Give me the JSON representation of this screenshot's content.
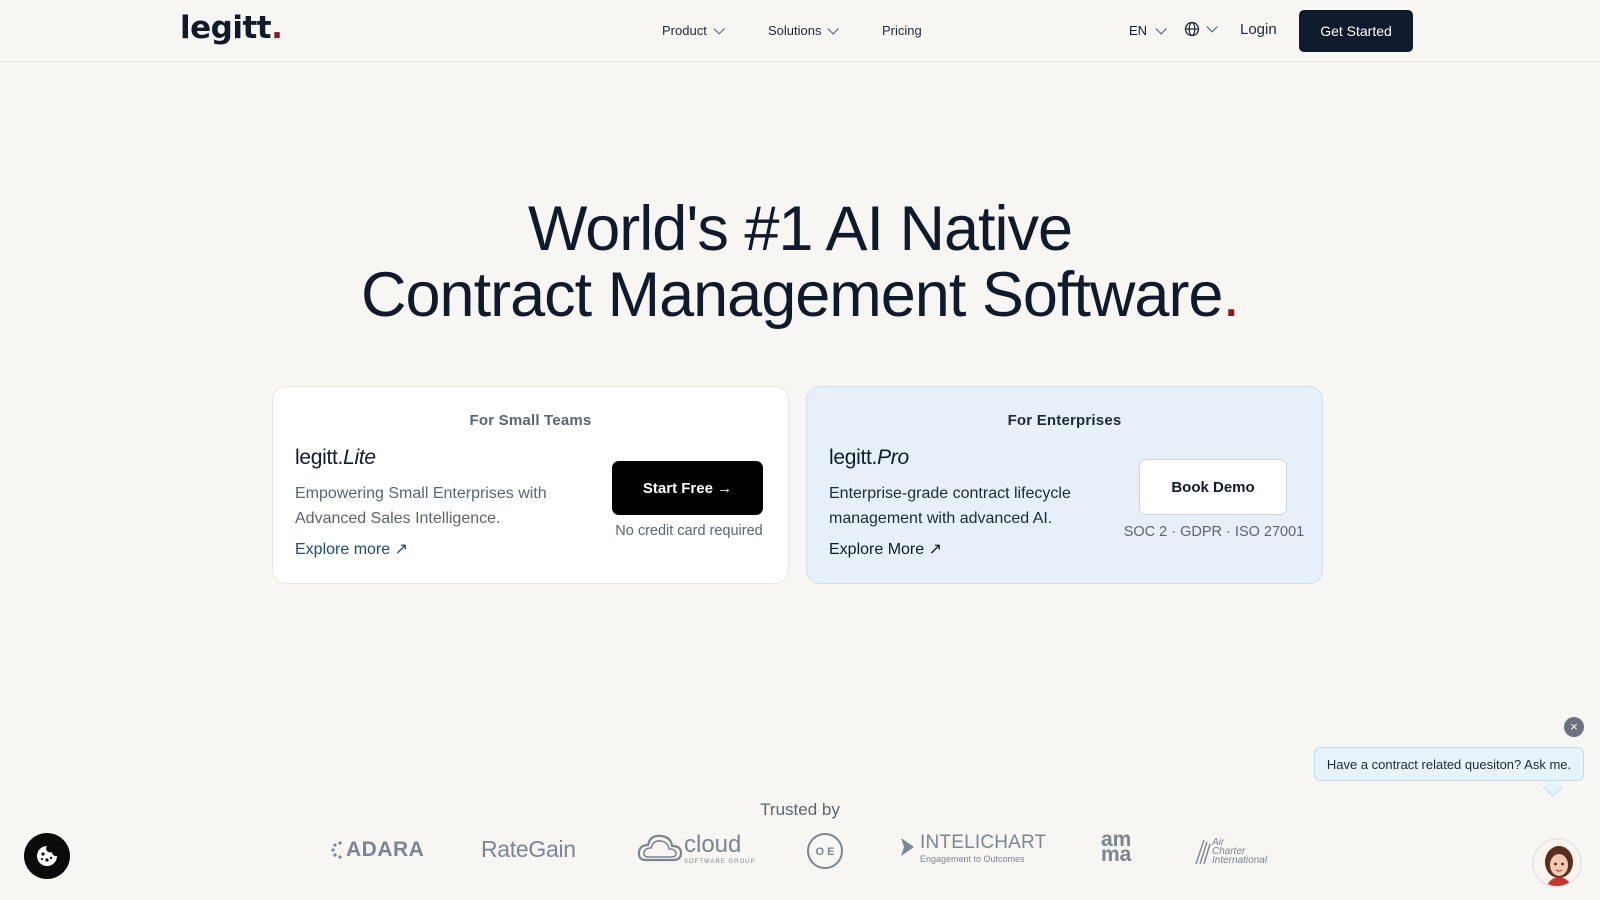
{
  "header": {
    "logo_text": "legitt",
    "logo_dot": ".",
    "nav": [
      {
        "label": "Product"
      },
      {
        "label": "Solutions"
      },
      {
        "label": "Pricing"
      }
    ],
    "language": "EN",
    "login_label": "Login",
    "get_started_label": "Get Started"
  },
  "hero": {
    "line1": "World's #1 AI Native",
    "line2": "Contract Management Software",
    "dot": "."
  },
  "cards": {
    "lite": {
      "kicker": "For Small Teams",
      "brand": "legitt.",
      "brand_suffix": "Lite",
      "description": "Empowering Small Enterprises with Advanced Sales Intelligence.",
      "explore_label": "Explore more ↗",
      "button_label": "Start Free →",
      "note": "No credit card required"
    },
    "pro": {
      "kicker": "For Enterprises",
      "brand": "legitt.",
      "brand_suffix": "Pro",
      "description": "Enterprise-grade contract lifecycle management with advanced AI.",
      "explore_label": "Explore More ↗",
      "button_label": "Book Demo",
      "note": "SOC 2 · GDPR · ISO 27001"
    }
  },
  "trusted": {
    "label": "Trusted by",
    "logos": {
      "adara": "ADARA",
      "rategain": "RateGain",
      "cloud": "cloud",
      "cloud_sub": "SOFTWARE GROUP",
      "one": "O E",
      "intelichart": "INTELICHART",
      "intelichart_sub": "Engagement to Outcomes",
      "amma_top": "am",
      "amma_bottom": "ma",
      "air1": "Air",
      "air2": "Charter",
      "air3": "International"
    }
  },
  "chat": {
    "close_glyph": "×",
    "prompt": "Have a contract related quesiton? Ask me."
  },
  "colors": {
    "brand_navy": "#0f1b2d",
    "accent_red": "#8b1a1a",
    "pro_card_bg": "#e7f0f9",
    "page_bg": "#f7f6f3"
  }
}
